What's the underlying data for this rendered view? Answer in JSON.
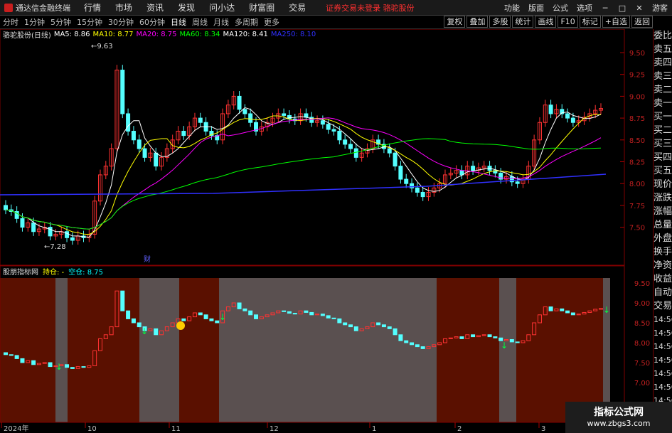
{
  "menubar": {
    "app_title": "通达信金融终端",
    "items": [
      "行情",
      "市场",
      "资讯",
      "发现",
      "问小达",
      "财富圈",
      "交易"
    ],
    "notice": "证券交易未登录",
    "stock_name": "骆驼股份",
    "right_items": [
      "功能",
      "版面",
      "公式",
      "选项",
      "游客"
    ]
  },
  "period_bar": {
    "items": [
      "分时",
      "1分钟",
      "5分钟",
      "15分钟",
      "30分钟",
      "60分钟",
      "日线",
      "周线",
      "月线",
      "多周期",
      "更多"
    ],
    "selected": "日线"
  },
  "toolbar": {
    "items": [
      "复权",
      "叠加",
      "多股",
      "统计",
      "画线",
      "F10",
      "标记",
      "+自选",
      "返回"
    ]
  },
  "indicator_line": {
    "title": "骆驼股份(日线)",
    "ma": [
      {
        "label": "MA5: 8.86",
        "color": "#ffffff"
      },
      {
        "label": "MA10: 8.77",
        "color": "#ffff00"
      },
      {
        "label": "MA20: 8.75",
        "color": "#ff00ff"
      },
      {
        "label": "MA60: 8.34",
        "color": "#00ff00"
      },
      {
        "label": "MA120: 8.41",
        "color": "#ffffff"
      },
      {
        "label": "MA250: 8.10",
        "color": "#3030ff"
      }
    ]
  },
  "main_chart": {
    "price_ticks": [
      "9.50",
      "9.25",
      "9.00",
      "8.75",
      "8.50",
      "8.25",
      "8.00",
      "7.75",
      "7.50"
    ],
    "high_label": "9.63",
    "low_label": "7.28",
    "marker": "财"
  },
  "sub_chart": {
    "title": "股朋指标网",
    "holding_label": "持仓: -",
    "empty_label": "空仓: 8.75",
    "price_ticks": [
      "9.50",
      "9.00",
      "8.50",
      "8.00",
      "7.50",
      "7.00"
    ]
  },
  "date_axis": {
    "labels": [
      "2024年",
      "10",
      "11",
      "12",
      "1",
      "2",
      "3"
    ]
  },
  "side_panel": {
    "items": [
      "委比",
      "卖五",
      "卖四",
      "卖三",
      "卖二",
      "卖一",
      "买一",
      "买二",
      "买三",
      "买四",
      "买五",
      "现价",
      "涨跌",
      "涨幅",
      "总量",
      "外盘",
      "换手",
      "净资",
      "收益",
      "自动",
      "交易"
    ],
    "times": [
      "14:56",
      "14:56",
      "14:56",
      "14:56",
      "14:56",
      "14:56",
      "14:56",
      "14:5"
    ]
  },
  "watermark": {
    "line1": "指标公式网",
    "line2": "www.zbgs3.com"
  }
}
